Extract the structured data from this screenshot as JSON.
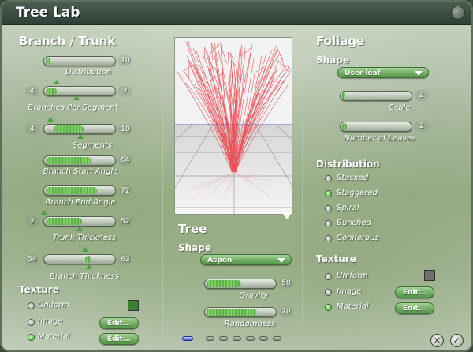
{
  "window": {
    "title": "Tree Lab"
  },
  "branch": {
    "heading": "Branch / Trunk",
    "distribution": {
      "label": "Distribution",
      "value": "10"
    },
    "branches_per_segment": {
      "label": "Branches Per Segment",
      "min": "4",
      "max": "7"
    },
    "segments": {
      "label": "Segments",
      "min": "4",
      "max": "10"
    },
    "branch_start_angle": {
      "label": "Branch Start Angle",
      "value": "64"
    },
    "branch_end_angle": {
      "label": "Branch End Angle",
      "value": "72"
    },
    "trunk_thickness": {
      "label": "Trunk Thickness",
      "min": "2",
      "max": "52"
    },
    "branch_thickness": {
      "label": "Branch Thickness",
      "min": "54",
      "max": "63"
    },
    "texture": {
      "heading": "Texture",
      "options": [
        "Uniform",
        "Image",
        "Material"
      ],
      "selected": "Material",
      "edit_label": "Edit...",
      "swatch_color": "#3f7f2f"
    }
  },
  "tree": {
    "heading": "Tree",
    "shape_label": "Shape",
    "shape_value": "Aspen",
    "gravity": {
      "label": "Gravity",
      "value": "50"
    },
    "randomness": {
      "label": "Randomness",
      "value": "70"
    }
  },
  "foliage": {
    "heading": "Foliage",
    "shape_label": "Shape",
    "shape_value": "User leaf",
    "scale": {
      "label": "Scale",
      "value": "2"
    },
    "number_of_leaves": {
      "label": "Number of Leaves",
      "value": "2"
    },
    "distribution": {
      "heading": "Distribution",
      "options": [
        "Stacked",
        "Staggered",
        "Spiral",
        "Bunched",
        "Coniferous"
      ],
      "selected": "Staggered"
    },
    "texture": {
      "heading": "Texture",
      "options": [
        "Uniform",
        "Image",
        "Material"
      ],
      "selected": "Material",
      "edit_label": "Edit...",
      "swatch_color": "#6e6e6e"
    }
  },
  "footer": {
    "cancel_icon": "close-icon",
    "ok_icon": "checkmark-icon",
    "pages": 6,
    "current_page": 1
  }
}
